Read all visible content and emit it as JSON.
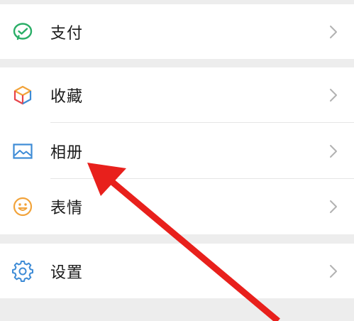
{
  "menu": {
    "groups": [
      {
        "items": [
          {
            "label": "支付",
            "icon": "wechat-pay-icon"
          }
        ]
      },
      {
        "items": [
          {
            "label": "收藏",
            "icon": "favorites-cube-icon"
          },
          {
            "label": "相册",
            "icon": "album-image-icon"
          },
          {
            "label": "表情",
            "icon": "smiley-face-icon"
          }
        ]
      },
      {
        "items": [
          {
            "label": "设置",
            "icon": "gear-icon"
          }
        ]
      }
    ]
  },
  "colors": {
    "background": "#ededed",
    "pay_green": "#2aae67",
    "album_blue": "#3d8bd6",
    "emoji_orange": "#f2a33a",
    "settings_blue": "#3d8bd6",
    "chevron_gray": "#b2b2b2",
    "annotation_red": "#e8201c"
  }
}
